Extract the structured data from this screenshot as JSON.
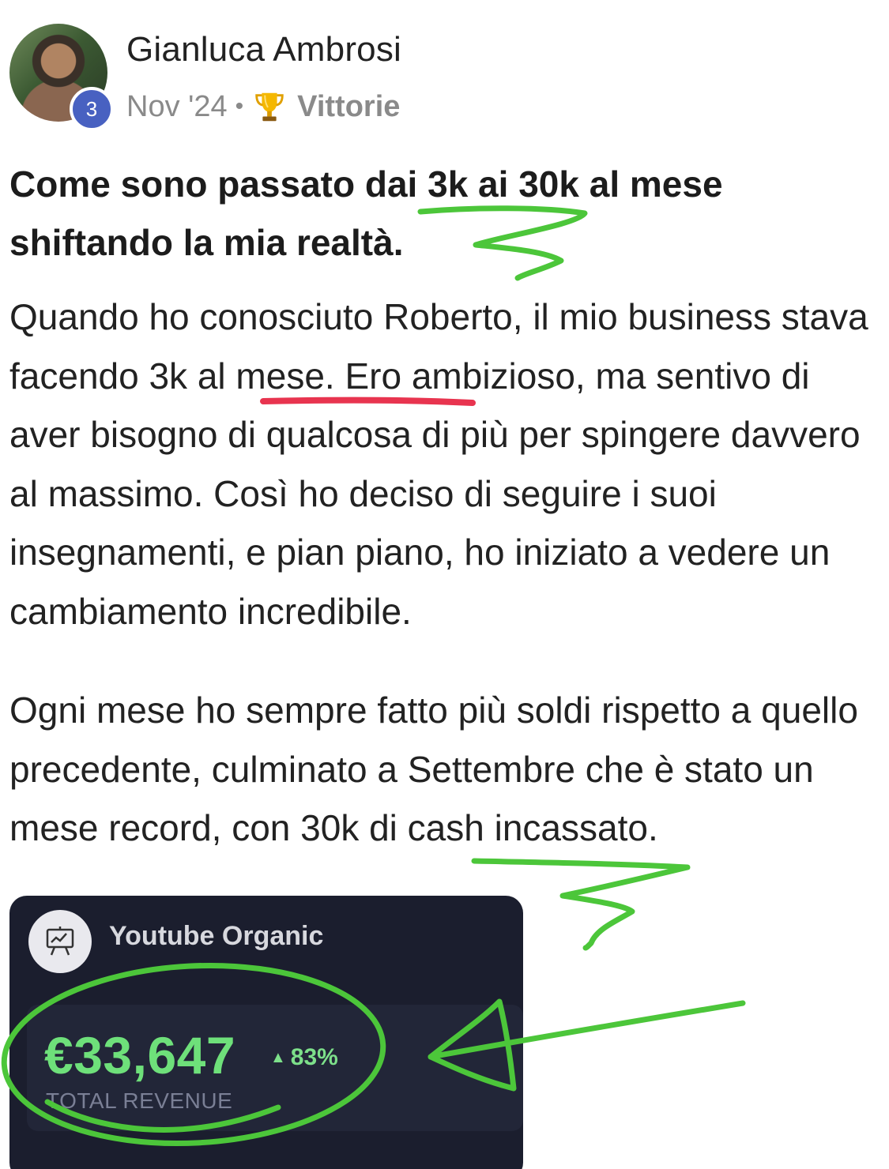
{
  "author": {
    "name": "Gianluca Ambrosi",
    "level": "3"
  },
  "meta": {
    "date": "Nov '24",
    "separator": "•",
    "category_icon": "trophy-icon",
    "category": "Vittorie"
  },
  "post": {
    "title": "Come sono passato dai 3k ai 30k al mese shiftando la mia realtà.",
    "paragraphs": [
      "Quando ho conosciuto Roberto, il mio business stava facendo 3k al mese. Ero ambizioso, ma sentivo di aver bisogno di qualcosa di più per spingere davvero al massimo. Così ho deciso di seguire i suoi insegnamenti, e pian piano, ho iniziato a vedere un cambiamento incredibile.",
      "Ogni mese ho sempre fatto più soldi rispetto a quello precedente, culminato a Settembre che è stato un mese record, con 30k di cash incassato."
    ]
  },
  "card": {
    "icon": "presentation-chart-icon",
    "title": "Youtube Organic",
    "value": "€33,647",
    "delta_arrow": "▲",
    "delta": "83%",
    "label": "TOTAL REVENUE"
  },
  "colors": {
    "badge": "#4861c1",
    "card_bg": "#1b1e2e",
    "revenue_green": "#6ee07a",
    "annotation_green": "#4cc63a",
    "annotation_red": "#e8344f"
  }
}
